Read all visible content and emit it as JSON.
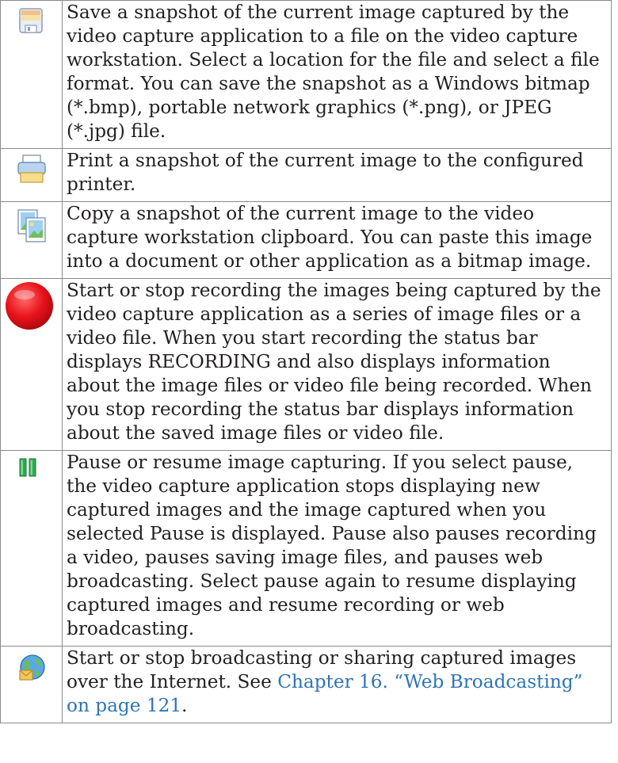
{
  "rows": [
    {
      "icon": "save-icon",
      "text": "Save a snapshot of the current image captured by the video capture application to a file on the video capture workstation. Select a location for the file and select a file format. You can save the snapshot as a Windows bitmap (*.bmp), portable network graphics (*.png), or JPEG (*.jpg) file."
    },
    {
      "icon": "print-icon",
      "text": "Print a snapshot of the current image to the configured printer."
    },
    {
      "icon": "copy-icon",
      "text": "Copy a snapshot of the current image to the video capture workstation clipboard. You can paste this image into a document or other application as a bitmap image."
    },
    {
      "icon": "record-icon",
      "text": "Start or stop recording the images being captured by the video capture application as a series of image files or a video file. When you start recording the status bar displays RECORDING and also displays information about the image files or video file being recorded. When you stop recording the status bar displays information about the saved image files or video file."
    },
    {
      "icon": "pause-icon",
      "text": "Pause or resume image capturing. If you select pause, the video capture application stops displaying new captured images and the image captured when you selected Pause is displayed. Pause also pauses recording a video, pauses saving image files, and pauses web broadcasting. Select pause again to resume displaying captured images and resume recording or web broadcasting."
    },
    {
      "icon": "web-broadcast-icon",
      "text": "Start or stop broadcasting or sharing captured images over the Internet. See ",
      "link": "Chapter 16. “Web Broadcasting” on page 121",
      "text_end": "."
    }
  ],
  "colors": {
    "text": "#231f20",
    "link": "#2e74b5",
    "border": "#8a8a8a",
    "record_red": "#e8131b",
    "pause_green": "#2fa84f"
  }
}
